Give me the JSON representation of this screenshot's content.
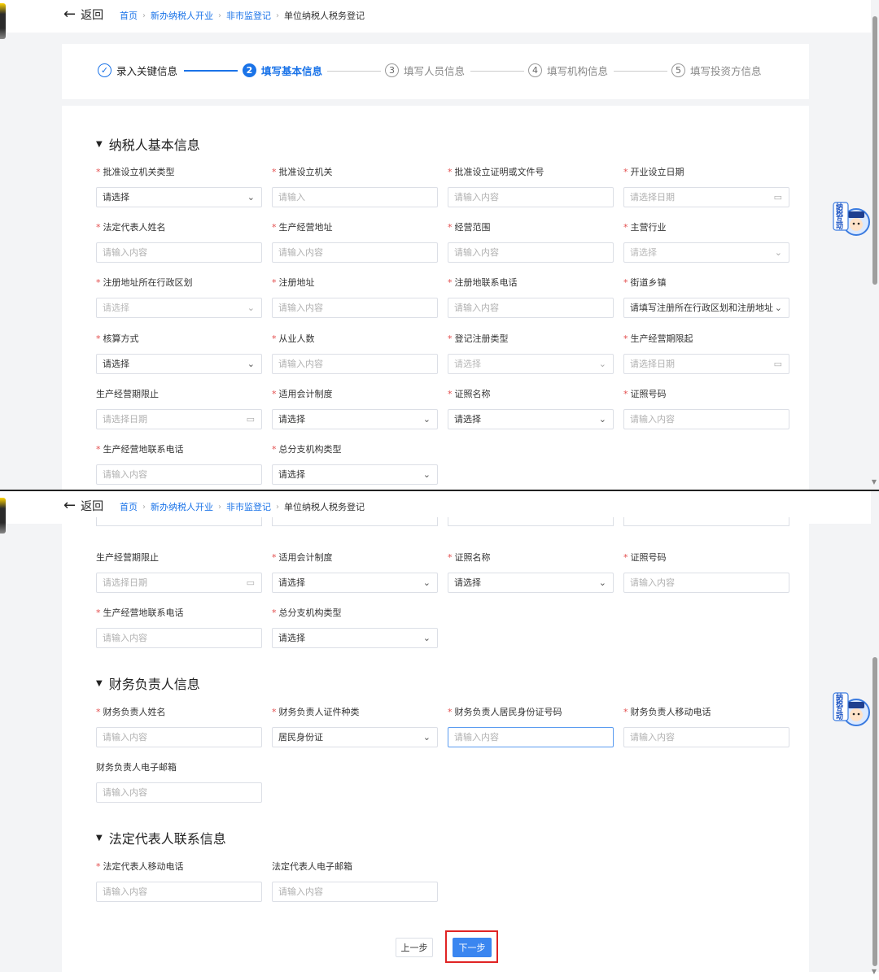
{
  "topbar": {
    "back_label": "返回",
    "breadcrumb": [
      "首页",
      "新办纳税人开业",
      "非市监登记",
      "单位纳税人税务登记"
    ]
  },
  "steps": [
    {
      "num": "✓",
      "label": "录入关键信息",
      "state": "done"
    },
    {
      "num": "2",
      "label": "填写基本信息",
      "state": "active"
    },
    {
      "num": "3",
      "label": "填写人员信息",
      "state": "todo"
    },
    {
      "num": "4",
      "label": "填写机构信息",
      "state": "todo"
    },
    {
      "num": "5",
      "label": "填写投资方信息",
      "state": "todo"
    }
  ],
  "sections": {
    "basic": "纳税人基本信息",
    "finance": "财务负责人信息",
    "legal": "法定代表人联系信息"
  },
  "fields": {
    "approve_org_type": {
      "label": "批准设立机关类型",
      "value": "请选择"
    },
    "approve_org": {
      "label": "批准设立机关",
      "placeholder": "请输入"
    },
    "approve_doc_no": {
      "label": "批准设立证明或文件号",
      "placeholder": "请输入内容"
    },
    "open_date": {
      "label": "开业设立日期",
      "placeholder": "请选择日期"
    },
    "legal_name": {
      "label": "法定代表人姓名",
      "placeholder": "请输入内容"
    },
    "biz_address": {
      "label": "生产经营地址",
      "placeholder": "请输入内容"
    },
    "biz_scope": {
      "label": "经营范围",
      "placeholder": "请输入内容"
    },
    "main_industry": {
      "label": "主营行业",
      "value": "请选择"
    },
    "reg_region": {
      "label": "注册地址所在行政区划",
      "value": "请选择"
    },
    "reg_address": {
      "label": "注册地址",
      "placeholder": "请输入内容"
    },
    "reg_phone": {
      "label": "注册地联系电话",
      "placeholder": "请输入内容"
    },
    "street": {
      "label": "街道乡镇",
      "value": "请填写注册所在行政区划和注册地址"
    },
    "accounting": {
      "label": "核算方式",
      "value": "请选择"
    },
    "staff_count": {
      "label": "从业人数",
      "placeholder": "请输入内容"
    },
    "reg_type": {
      "label": "登记注册类型",
      "value": "请选择"
    },
    "period_start": {
      "label": "生产经营期限起",
      "placeholder": "请选择日期"
    },
    "period_end": {
      "label": "生产经营期限止",
      "placeholder": "请选择日期"
    },
    "acct_system": {
      "label": "适用会计制度",
      "value": "请选择"
    },
    "cert_name": {
      "label": "证照名称",
      "value": "请选择"
    },
    "cert_no": {
      "label": "证照号码",
      "placeholder": "请输入内容"
    },
    "biz_phone": {
      "label": "生产经营地联系电话",
      "placeholder": "请输入内容"
    },
    "branch_type": {
      "label": "总分支机构类型",
      "value": "请选择"
    },
    "fin_name": {
      "label": "财务负责人姓名",
      "placeholder": "请输入内容"
    },
    "fin_id_type": {
      "label": "财务负责人证件种类",
      "value": "居民身份证"
    },
    "fin_id_no": {
      "label": "财务负责人居民身份证号码",
      "placeholder": "请输入内容"
    },
    "fin_mobile": {
      "label": "财务负责人移动电话",
      "placeholder": "请输入内容"
    },
    "fin_email": {
      "label": "财务负责人电子邮箱",
      "placeholder": "请输入内容"
    },
    "legal_mobile": {
      "label": "法定代表人移动电话",
      "placeholder": "请输入内容"
    },
    "legal_email": {
      "label": "法定代表人电子邮箱",
      "placeholder": "请输入内容"
    }
  },
  "floating": {
    "text": "纳税互动"
  },
  "buttons": {
    "prev": "上一步",
    "next": "下一步"
  }
}
